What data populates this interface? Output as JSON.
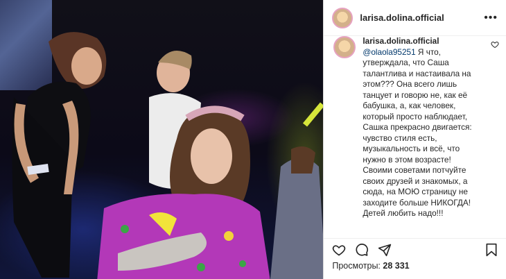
{
  "post": {
    "username": "larisa.dolina.official",
    "more_label": "•••",
    "caption": {
      "author": "larisa.dolina.official",
      "mention": "@olaola95251",
      "text": " Я что, утверждала, что Саша талантлива и настаивала на этом??? Она всего лишь танцует и говорю не, как её бабушка, а, как человек, который просто наблюдает, Сашка прекрасно двигается: чувство стиля есть, музыкальность и всё, что нужно в этом возрасте! Своими советами потчуйте своих друзей и знакомых, а сюда, на МОЮ страницу не заходите больше НИКОГДА! Детей любить надо!!!"
    },
    "views": {
      "label": "Просмотры:",
      "count": "28 331"
    },
    "icons": {
      "like": "heart-icon",
      "comment": "comment-icon",
      "share": "send-icon",
      "save": "bookmark-icon",
      "caption_like": "small-heart-icon"
    }
  }
}
